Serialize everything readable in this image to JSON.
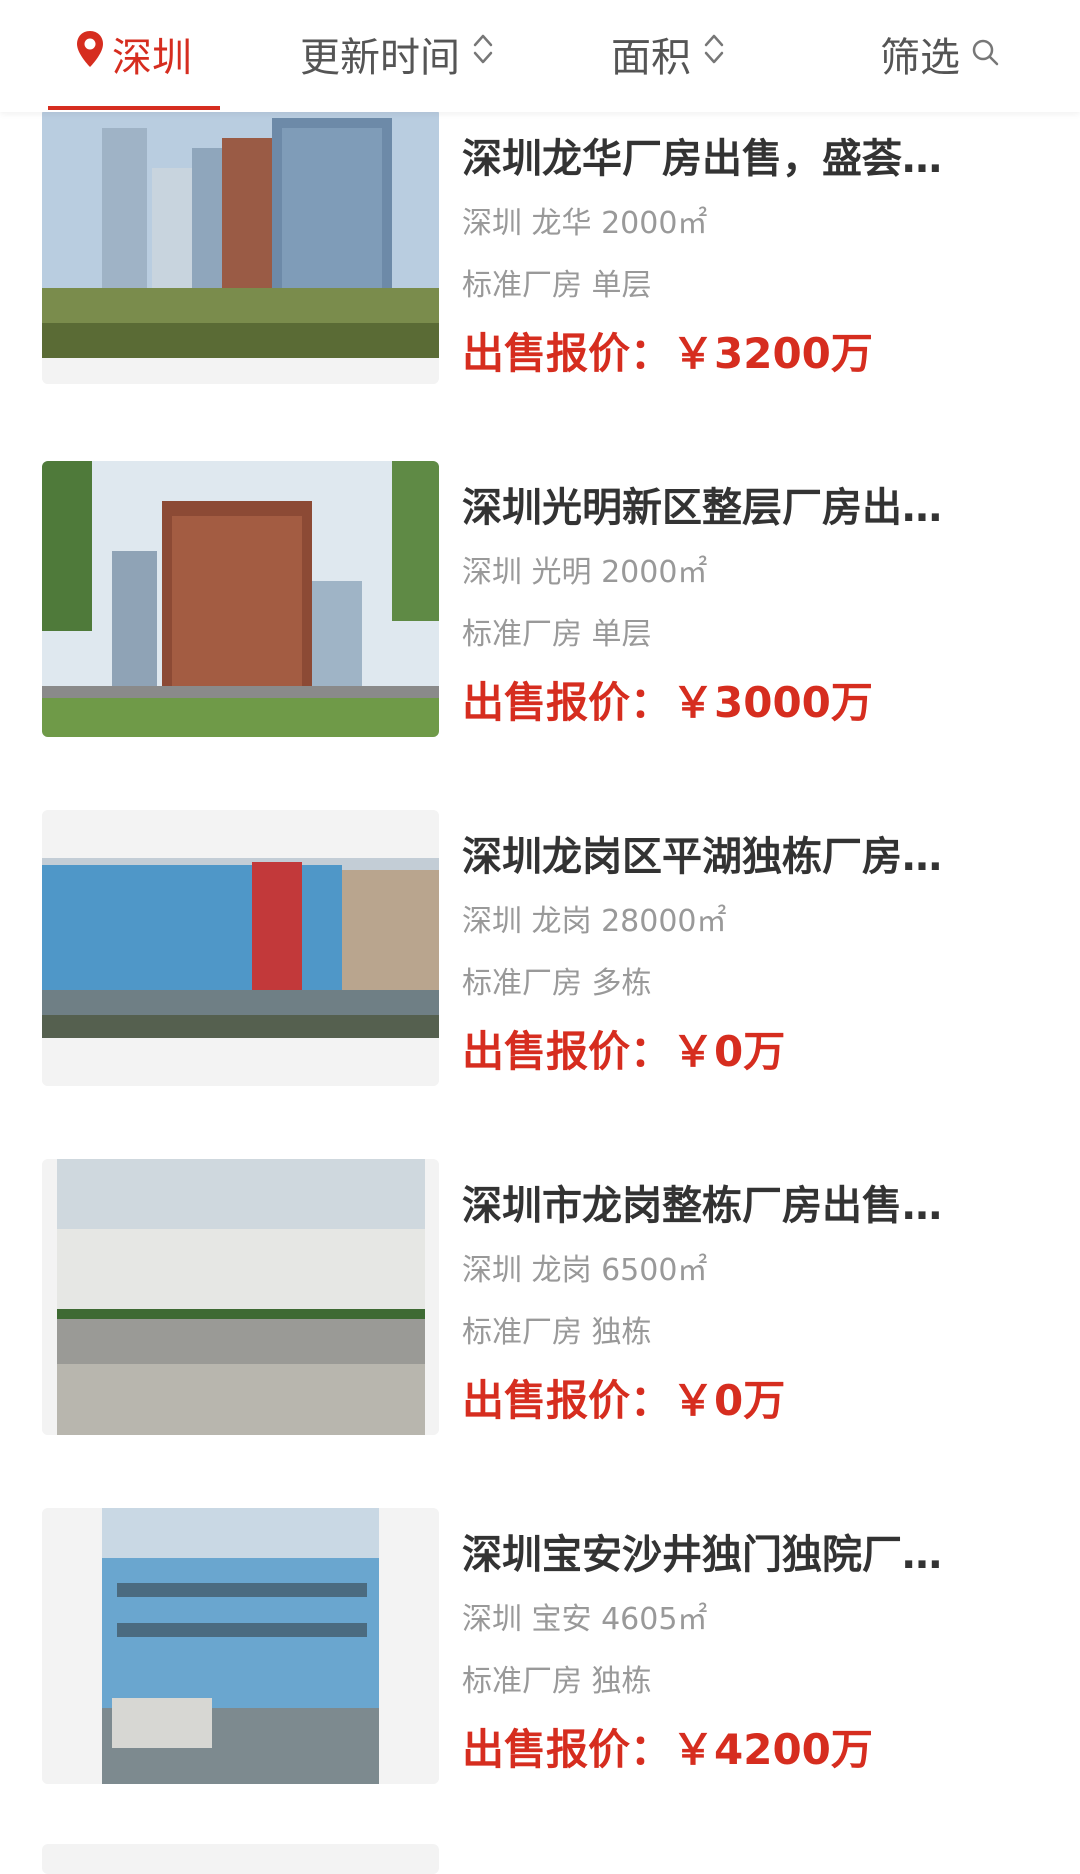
{
  "topbar": {
    "city": "深圳",
    "sort_time": "更新时间",
    "sort_area": "面积",
    "filter": "筛选",
    "accent_color": "#d62d1f"
  },
  "listings": [
    {
      "title": "深圳龙华厂房出售，盛荟…",
      "location": "深圳 龙华 2000㎡",
      "type": "标准厂房 单层",
      "price": "出售报价：￥3200万"
    },
    {
      "title": "深圳光明新区整层厂房出…",
      "location": "深圳 光明 2000㎡",
      "type": "标准厂房 单层",
      "price": "出售报价：￥3000万"
    },
    {
      "title": "深圳龙岗区平湖独栋厂房…",
      "location": "深圳 龙岗 28000㎡",
      "type": "标准厂房 多栋",
      "price": "出售报价：￥0万"
    },
    {
      "title": "深圳市龙岗整栋厂房出售…",
      "location": "深圳 龙岗 6500㎡",
      "type": "标准厂房 独栋",
      "price": "出售报价：￥0万"
    },
    {
      "title": "深圳宝安沙井独门独院厂…",
      "location": "深圳 宝安 4605㎡",
      "type": "标准厂房 独栋",
      "price": "出售报价：￥4200万"
    }
  ]
}
